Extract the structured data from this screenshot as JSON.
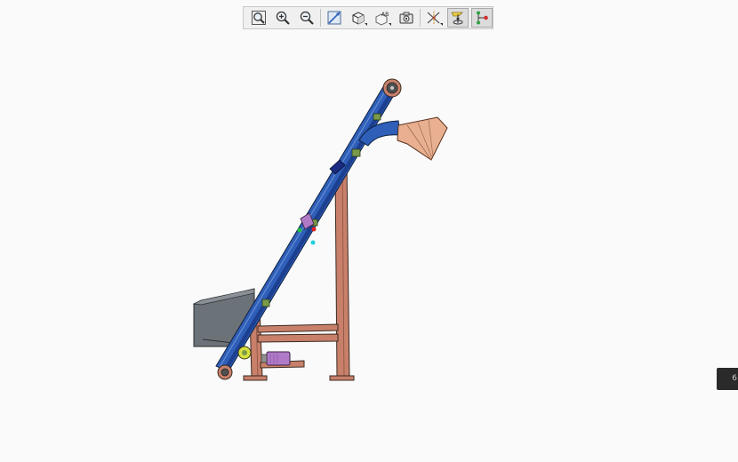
{
  "toolbar": {
    "buttons": [
      {
        "name": "zoom-to-fit-button",
        "icon": "zoom-fit-icon"
      },
      {
        "name": "zoom-in-button",
        "icon": "zoom-in-icon"
      },
      {
        "name": "zoom-out-button",
        "icon": "zoom-out-icon"
      },
      {
        "name": "zoom-area-button",
        "icon": "zoom-area-icon"
      },
      {
        "name": "view-orientation-button",
        "icon": "cube-icon",
        "dropdown": true
      },
      {
        "name": "annotation-display-button",
        "icon": "annotation-icon",
        "dropdown": true,
        "label": "AB"
      },
      {
        "name": "snapshot-button",
        "icon": "camera-icon"
      },
      {
        "name": "datum-display-button",
        "icon": "datum-icon",
        "dropdown": true
      },
      {
        "name": "spin-center-button",
        "icon": "spin-center-icon",
        "active": true
      },
      {
        "name": "connection-display-button",
        "icon": "connection-icon",
        "active": true
      }
    ]
  },
  "colors": {
    "background": "#fafafa",
    "frame": "#c8806a",
    "belt": "#2f5fb8",
    "hopper_gray": "#6b7278",
    "chute": "#e8b090",
    "motor": "#b07ac8",
    "bracket_green": "#7a9a4a"
  },
  "edge_tab": {
    "text": "6"
  }
}
